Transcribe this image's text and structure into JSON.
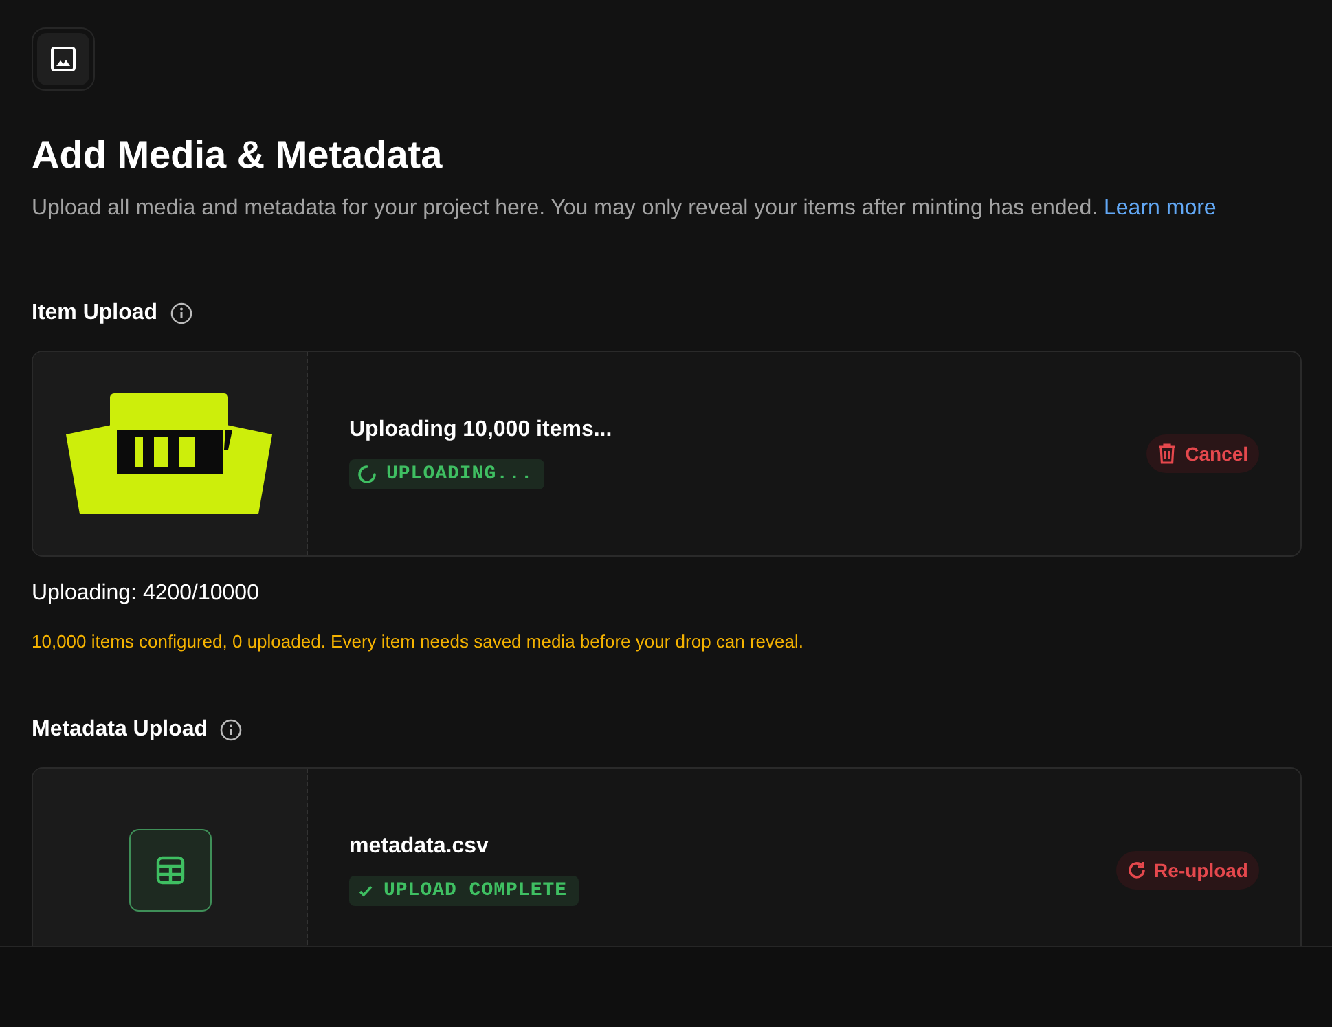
{
  "header": {
    "title": "Add Media & Metadata",
    "description": "Upload all media and metadata for your project here. You may only reveal your items after minting has ended.",
    "link": "Learn more"
  },
  "sections": [
    {
      "title": "Item Upload",
      "file": {
        "name": "Uploading 10,000 items...",
        "status": {
          "kind": "uploading",
          "label": "UPLOADING..."
        },
        "action": {
          "kind": "cancel",
          "label": "Cancel"
        }
      },
      "progress": "Uploading: 4200/10000",
      "warning": "10,000 items configured, 0 uploaded. Every item needs saved media before your drop can reveal."
    },
    {
      "title": "Metadata Upload",
      "file": {
        "preview": {
          "kind": "table"
        },
        "name": "metadata.csv",
        "status": {
          "kind": "complete",
          "label": "UPLOAD COMPLETE"
        },
        "action": {
          "kind": "reupload",
          "label": "Re-upload"
        }
      }
    }
  ]
}
